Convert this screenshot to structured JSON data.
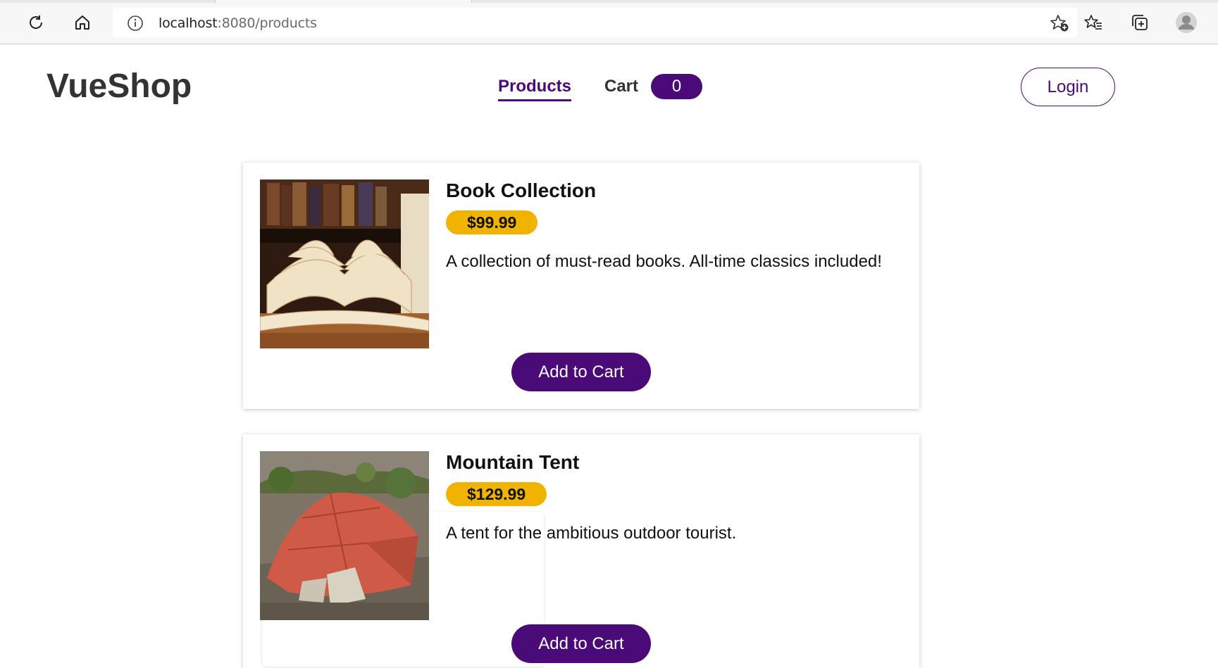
{
  "browser": {
    "url_host": "localhost",
    "url_rest": ":8080/products",
    "icons": [
      "reload-icon",
      "home-icon",
      "site-info-icon",
      "add-favorite-icon",
      "favorites-icon",
      "collections-icon",
      "profile-icon"
    ]
  },
  "header": {
    "brand": "VueShop",
    "nav": {
      "products": "Products",
      "cart": "Cart"
    },
    "cart_count": "0",
    "login": "Login"
  },
  "products": [
    {
      "title": "Book Collection",
      "price": "$99.99",
      "description": "A collection of must-read books. All-time classics included!",
      "button": "Add to Cart",
      "image": "open-books-image"
    },
    {
      "title": "Mountain Tent",
      "price": "$129.99",
      "description": "A tent for the ambitious outdoor tourist.",
      "button": "Add to Cart",
      "image": "red-tent-image"
    }
  ],
  "colors": {
    "accent": "#4a0a77",
    "price_badge": "#f0b400",
    "brand_text": "#333333"
  }
}
